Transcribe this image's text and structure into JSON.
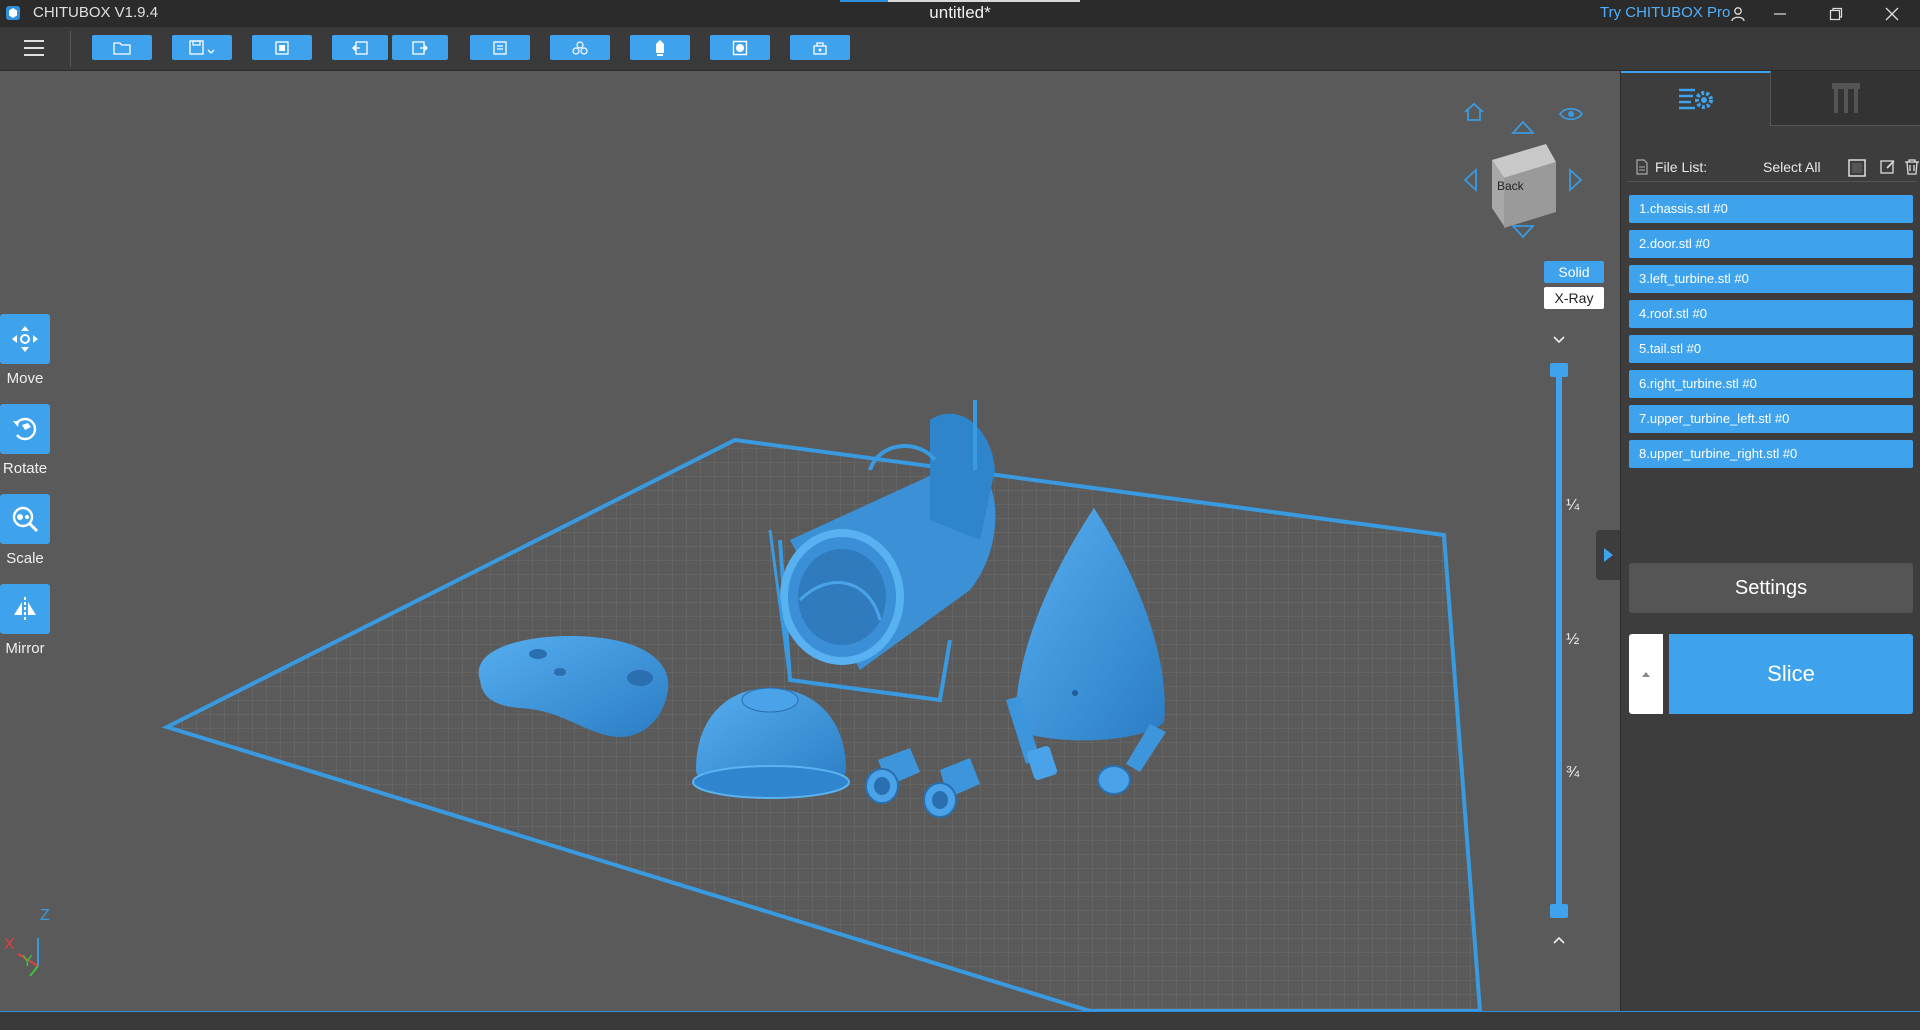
{
  "titlebar": {
    "app_title": "CHITUBOX V1.9.4",
    "doc_title": "untitled*",
    "pro_link": "Try CHITUBOX Pro"
  },
  "toolbar": {
    "buttons": [
      "open-file",
      "save",
      "screenshot",
      "undo",
      "redo",
      "layout",
      "duplicate",
      "supports",
      "hollow",
      "dig-hole"
    ]
  },
  "left_tools": [
    {
      "label": "Move"
    },
    {
      "label": "Rotate"
    },
    {
      "label": "Scale"
    },
    {
      "label": "Mirror"
    }
  ],
  "view": {
    "cube_face": "Back",
    "solid": "Solid",
    "xray": "X-Ray",
    "ticks": [
      "¼",
      "½",
      "¾"
    ]
  },
  "axes": {
    "z": "Z",
    "x": "X",
    "y": "Y"
  },
  "panel": {
    "file_list_label": "File List:",
    "select_all": "Select All",
    "files": [
      "1.chassis.stl #0",
      "2.door.stl #0",
      "3.left_turbine.stl #0",
      "4.roof.stl #0",
      "5.tail.stl #0",
      "6.right_turbine.stl #0",
      "7.upper_turbine_left.stl #0",
      "8.upper_turbine_right.stl #0"
    ],
    "settings": "Settings",
    "slice": "Slice"
  },
  "colors": {
    "accent": "#3ea3ec",
    "model": "#3a8fd6",
    "background": "#5a5a5a"
  }
}
